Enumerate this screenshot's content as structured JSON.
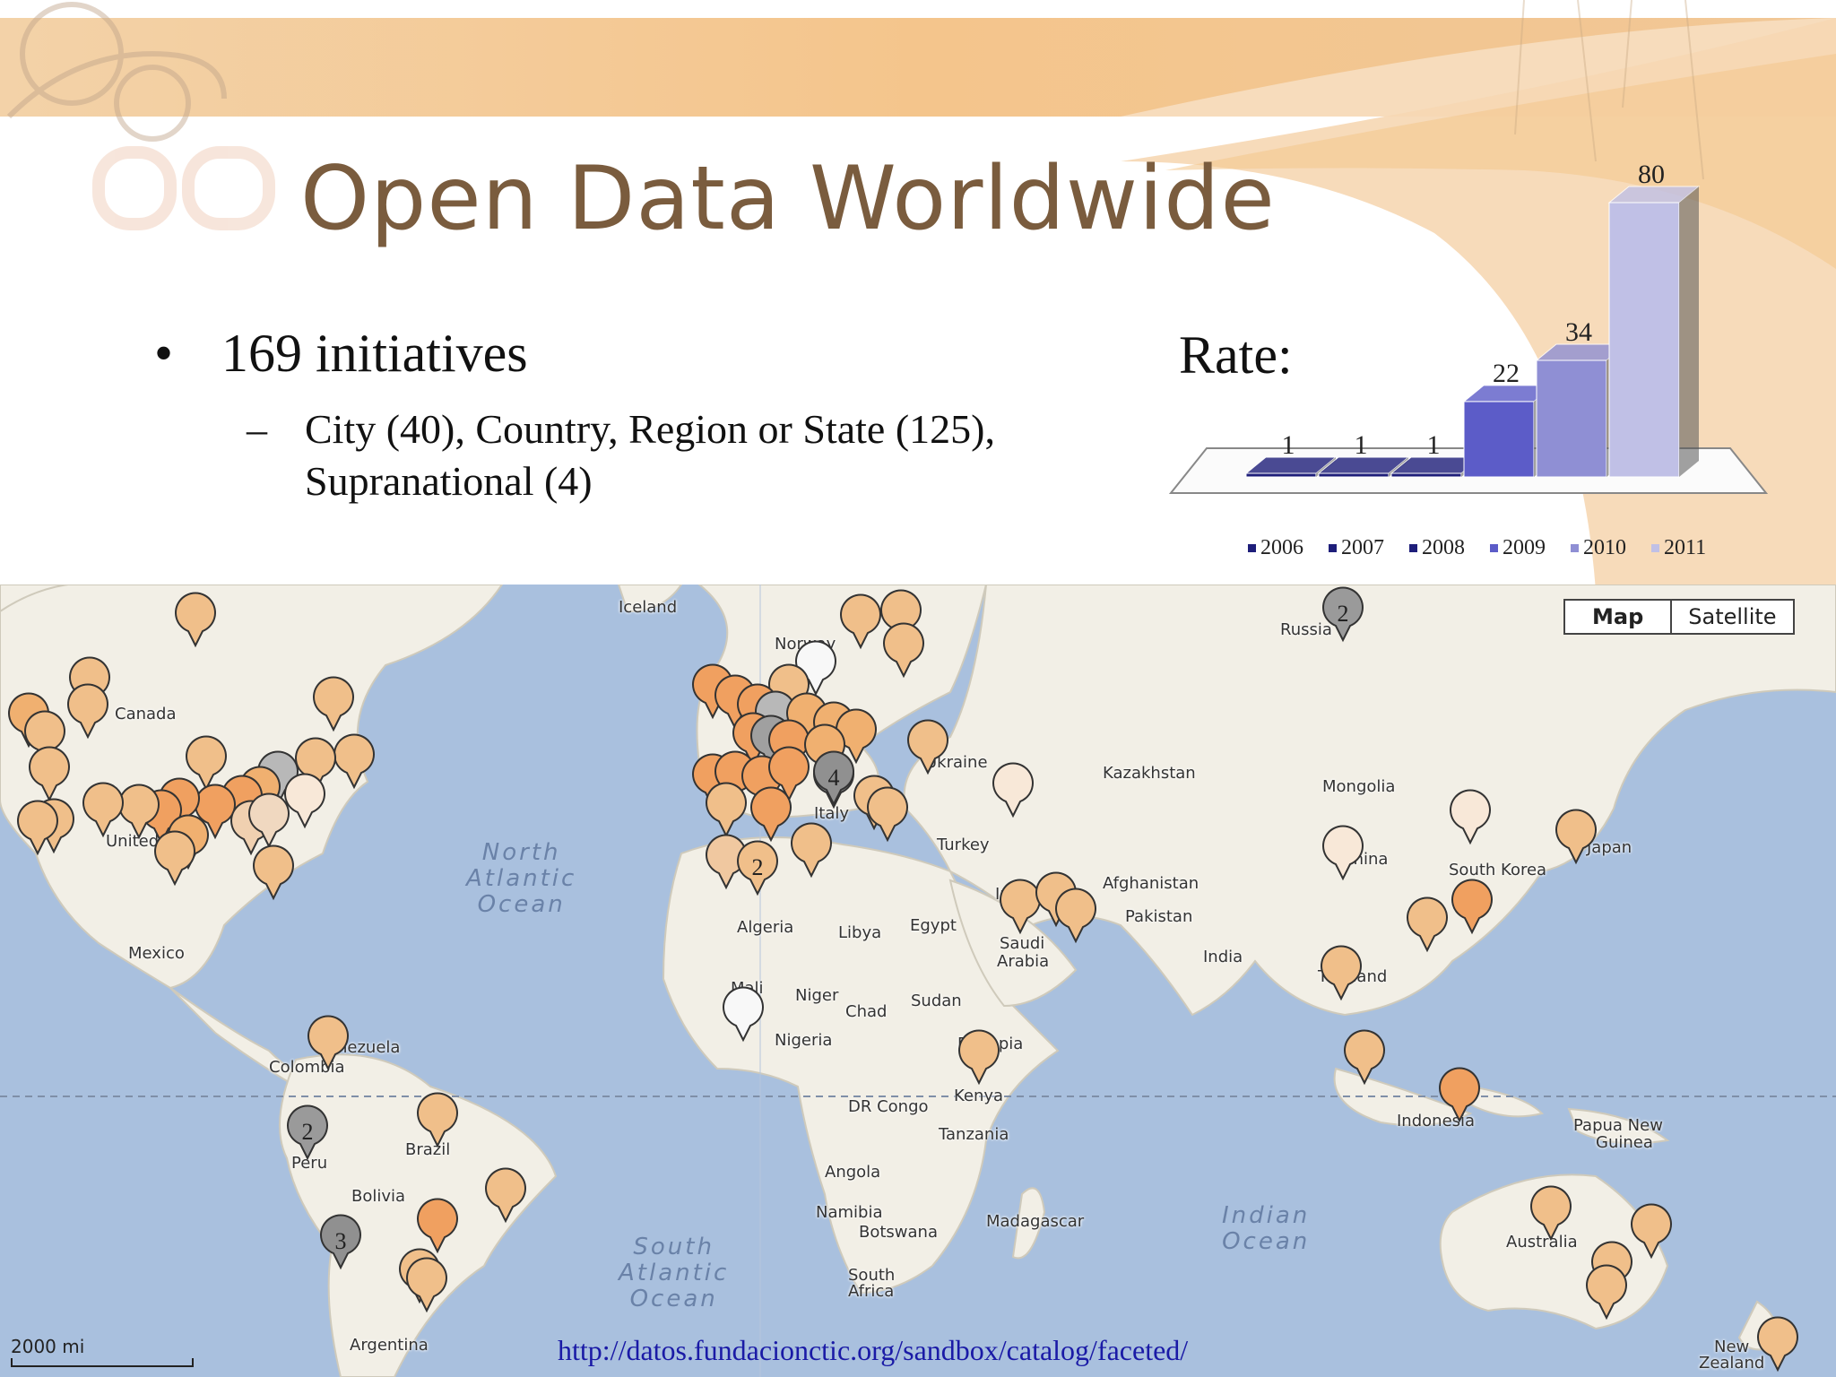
{
  "slide": {
    "title": "Open Data Worldwide",
    "bullet": "169 initiatives",
    "sub_line1": "City (40), Country, Region or State (125),",
    "sub_line2": "Supranational (4)",
    "rate_label": "Rate:",
    "url": "http://datos.fundacionctic.org/sandbox/catalog/faceted/"
  },
  "chart_data": {
    "type": "bar",
    "categories": [
      "2006",
      "2007",
      "2008",
      "2009",
      "2010",
      "2011"
    ],
    "values": [
      1,
      1,
      1,
      22,
      34,
      80
    ],
    "colors": [
      "#1e1e7a",
      "#1e1e7a",
      "#1e1e7a",
      "#5c5cc8",
      "#8f8fd4",
      "#c0c0e6"
    ],
    "ylim": [
      0,
      80
    ]
  },
  "map": {
    "type_buttons": [
      "Map",
      "Satellite"
    ],
    "scale_label": "2000 mi",
    "labels": [
      {
        "text": "Iceland",
        "x": 690,
        "y": 15
      },
      {
        "text": "Norway",
        "x": 864,
        "y": 56
      },
      {
        "text": "Russia",
        "x": 1428,
        "y": 40
      },
      {
        "text": "Canada",
        "x": 128,
        "y": 134
      },
      {
        "text": "United",
        "x": 118,
        "y": 276
      },
      {
        "text": "Kazakhstan",
        "x": 1230,
        "y": 200
      },
      {
        "text": "Mongolia",
        "x": 1475,
        "y": 215
      },
      {
        "text": "Ukraine",
        "x": 1032,
        "y": 188
      },
      {
        "text": "Italy",
        "x": 908,
        "y": 245
      },
      {
        "text": "Turkey",
        "x": 1045,
        "y": 280
      },
      {
        "text": "China",
        "x": 1497,
        "y": 296
      },
      {
        "text": "South Korea",
        "x": 1616,
        "y": 308
      },
      {
        "text": "Japan",
        "x": 1770,
        "y": 283
      },
      {
        "text": "Afghanistan",
        "x": 1230,
        "y": 323
      },
      {
        "text": "Pakistan",
        "x": 1255,
        "y": 360
      },
      {
        "text": "Iran",
        "x": 1110,
        "y": 335
      },
      {
        "text": "Algeria",
        "x": 822,
        "y": 372
      },
      {
        "text": "Libya",
        "x": 935,
        "y": 378
      },
      {
        "text": "Egypt",
        "x": 1015,
        "y": 370
      },
      {
        "text": "Saudi",
        "x": 1115,
        "y": 390
      },
      {
        "text": "Arabia",
        "x": 1112,
        "y": 410
      },
      {
        "text": "India",
        "x": 1342,
        "y": 405
      },
      {
        "text": "Thailand",
        "x": 1470,
        "y": 427
      },
      {
        "text": "Mexico",
        "x": 143,
        "y": 401
      },
      {
        "text": "Mali",
        "x": 815,
        "y": 440
      },
      {
        "text": "Niger",
        "x": 887,
        "y": 448
      },
      {
        "text": "Chad",
        "x": 943,
        "y": 466
      },
      {
        "text": "Sudan",
        "x": 1016,
        "y": 454
      },
      {
        "text": "Nigeria",
        "x": 864,
        "y": 498
      },
      {
        "text": "Ethiopia",
        "x": 1068,
        "y": 502
      },
      {
        "text": "Venezuela",
        "x": 354,
        "y": 506
      },
      {
        "text": "Colombia",
        "x": 300,
        "y": 528
      },
      {
        "text": "Kenya",
        "x": 1064,
        "y": 560
      },
      {
        "text": "DR Congo",
        "x": 946,
        "y": 572
      },
      {
        "text": "Tanzania",
        "x": 1047,
        "y": 603
      },
      {
        "text": "Indonesia",
        "x": 1558,
        "y": 588
      },
      {
        "text": "Papua New",
        "x": 1755,
        "y": 593
      },
      {
        "text": "Guinea",
        "x": 1780,
        "y": 612
      },
      {
        "text": "Peru",
        "x": 325,
        "y": 635
      },
      {
        "text": "Brazil",
        "x": 452,
        "y": 620
      },
      {
        "text": "Angola",
        "x": 920,
        "y": 645
      },
      {
        "text": "Bolivia",
        "x": 392,
        "y": 672
      },
      {
        "text": "Namibia",
        "x": 910,
        "y": 690
      },
      {
        "text": "Botswana",
        "x": 958,
        "y": 712
      },
      {
        "text": "Madagascar",
        "x": 1100,
        "y": 700
      },
      {
        "text": "Australia",
        "x": 1680,
        "y": 723
      },
      {
        "text": "South",
        "x": 946,
        "y": 760
      },
      {
        "text": "Africa",
        "x": 946,
        "y": 778
      },
      {
        "text": "Argentina",
        "x": 390,
        "y": 838
      },
      {
        "text": "New",
        "x": 1912,
        "y": 840
      },
      {
        "text": "Zealand",
        "x": 1895,
        "y": 858
      }
    ],
    "oceans": [
      {
        "text": "North\nAtlantic\nOcean",
        "x": 520,
        "y": 285
      },
      {
        "text": "South\nAtlantic\nOcean",
        "x": 690,
        "y": 725
      },
      {
        "text": "Indian\nOcean",
        "x": 1363,
        "y": 690
      }
    ]
  }
}
